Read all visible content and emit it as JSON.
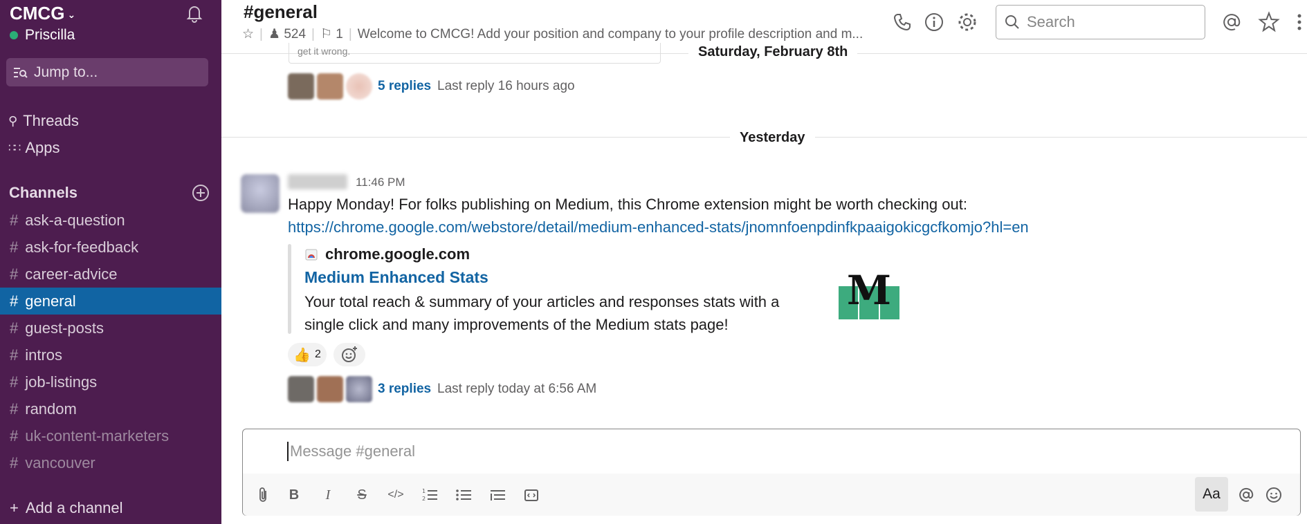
{
  "workspace": {
    "name": "CMCG",
    "user": "Priscilla"
  },
  "sidebar": {
    "jump_to": "Jump to...",
    "nav": [
      {
        "label": "Threads",
        "icon": "threads-icon"
      },
      {
        "label": "Apps",
        "icon": "apps-icon"
      }
    ],
    "channels_heading": "Channels",
    "channels": [
      {
        "name": "ask-a-question",
        "state": "normal"
      },
      {
        "name": "ask-for-feedback",
        "state": "normal"
      },
      {
        "name": "career-advice",
        "state": "normal"
      },
      {
        "name": "general",
        "state": "active"
      },
      {
        "name": "guest-posts",
        "state": "normal"
      },
      {
        "name": "intros",
        "state": "normal"
      },
      {
        "name": "job-listings",
        "state": "normal"
      },
      {
        "name": "random",
        "state": "normal"
      },
      {
        "name": "uk-content-marketers",
        "state": "muted"
      },
      {
        "name": "vancouver",
        "state": "muted"
      }
    ],
    "add_channel": "Add a channel"
  },
  "header": {
    "channel": "#general",
    "members": "524",
    "pins": "1",
    "topic": "Welcome to CMCG! Add your position and company to your profile description and m...",
    "search_placeholder": "Search"
  },
  "messages": {
    "prev_snippet": "get it wrong.",
    "date_saturday": "Saturday, February 8th",
    "prev_thread": {
      "replies": "5 replies",
      "last": "Last reply 16 hours ago"
    },
    "date_yesterday": "Yesterday",
    "post": {
      "time": "11:46 PM",
      "text": "Happy Monday! For folks publishing on Medium, this Chrome extension might be worth checking out:",
      "link": "https://chrome.google.com/webstore/detail/medium-enhanced-stats/jnomnfoenpdinfkpaaigokicgcfkomjo?hl=en",
      "attachment": {
        "source": "chrome.google.com",
        "title": "Medium Enhanced Stats",
        "desc": "Your total reach & summary of your articles and responses stats with a single click and many improvements of the Medium stats page!",
        "logo_letter": "M"
      },
      "reaction_count": "2",
      "thread": {
        "replies": "3 replies",
        "last": "Last reply today at 6:56 AM"
      }
    }
  },
  "composer": {
    "placeholder": "Message #general",
    "aa": "Aa"
  },
  "colors": {
    "sidebar": "#4d1d4f",
    "active": "#1164a3",
    "link": "#1264a3",
    "presence": "#2bac76",
    "medium_green": "#3dab7e"
  }
}
